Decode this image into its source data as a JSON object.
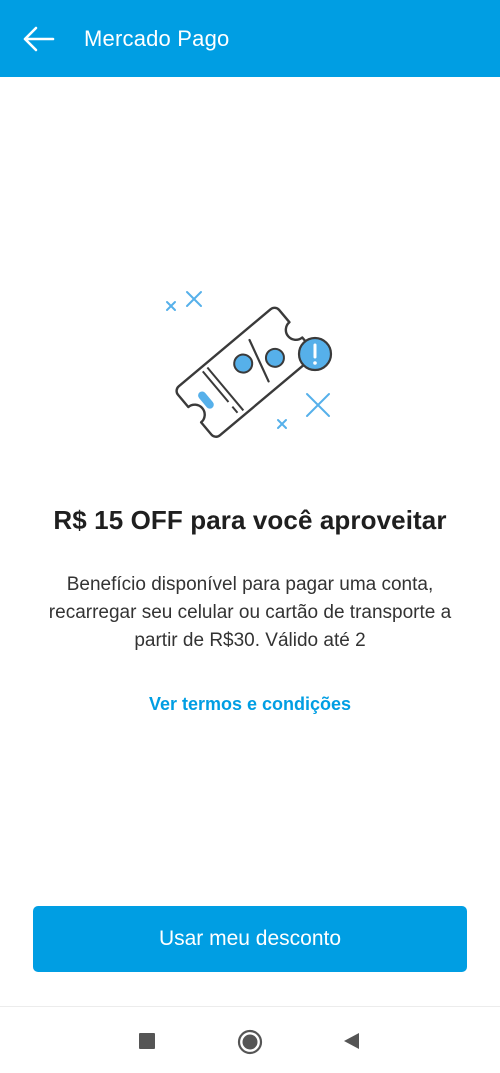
{
  "app_bar": {
    "title": "Mercado Pago",
    "back_icon": "arrow-left-icon",
    "background_color": "#009ee3"
  },
  "illustration": {
    "icon": "discount-ticket-icon",
    "accent_color": "#56b0ea"
  },
  "content": {
    "headline": "R$ 15 OFF para você aproveitar",
    "description": "Benefício disponível para pagar uma conta, recarregar seu celular ou cartão de transporte a partir de R$30. Válido até 2",
    "terms_link": "Ver termos e condições"
  },
  "primary_action": {
    "label": "Usar meu desconto",
    "color": "#009ee3"
  },
  "system_nav": {
    "recents_icon": "square-recents-icon",
    "home_icon": "circle-home-icon",
    "back_icon": "triangle-back-icon"
  }
}
